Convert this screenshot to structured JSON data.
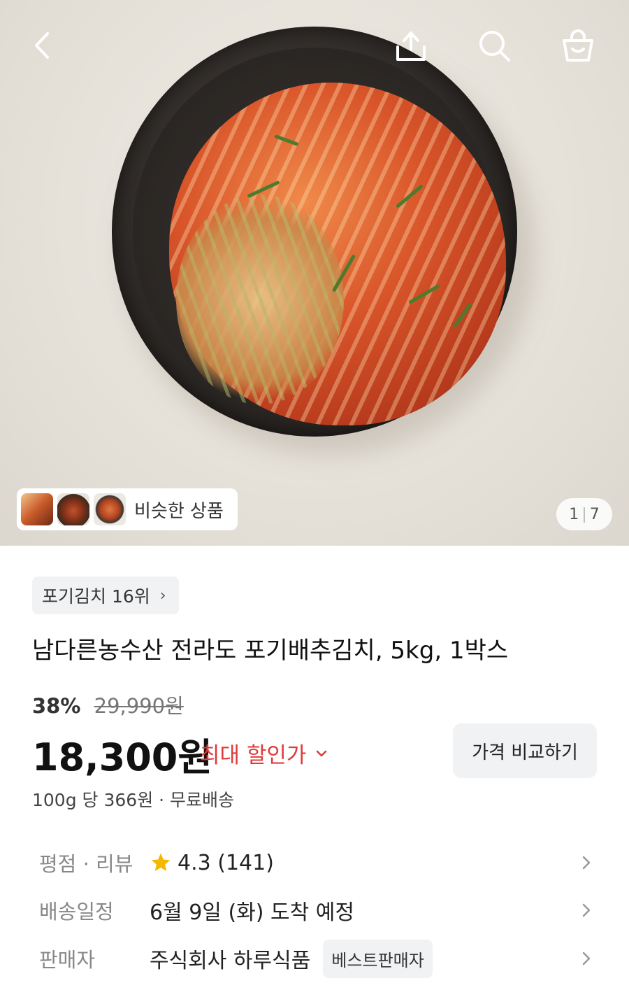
{
  "header": {
    "back_icon": "back-chevron-icon",
    "share_icon": "share-icon",
    "search_icon": "search-icon",
    "cart_icon": "cart-bag-icon"
  },
  "gallery": {
    "similar_label": "비슷한 상품",
    "pager_current": "1",
    "pager_total": "7"
  },
  "product": {
    "rank_label": "포기김치 16위",
    "title": "남다른농수산 전라도 포기배추김치, 5kg, 1박스",
    "discount_pct": "38%",
    "original_price": "29,990원",
    "price": "18,300원",
    "max_discount_label": "최대 할인가",
    "compare_label": "가격 비교하기",
    "unit_price": "100g 당 366원 · 무료배송"
  },
  "details": {
    "rating_label": "평점 · 리뷰",
    "rating_value": "4.3 (141)",
    "delivery_label": "배송일정",
    "delivery_value": "6월 9일 (화) 도착 예정",
    "seller_label": "판매자",
    "seller_value": "주식회사 하루식품",
    "seller_badge": "베스트판매자"
  },
  "colors": {
    "accent_red": "#e03a3a",
    "star_yellow": "#f5b800",
    "chip_bg": "#f1f2f4"
  }
}
